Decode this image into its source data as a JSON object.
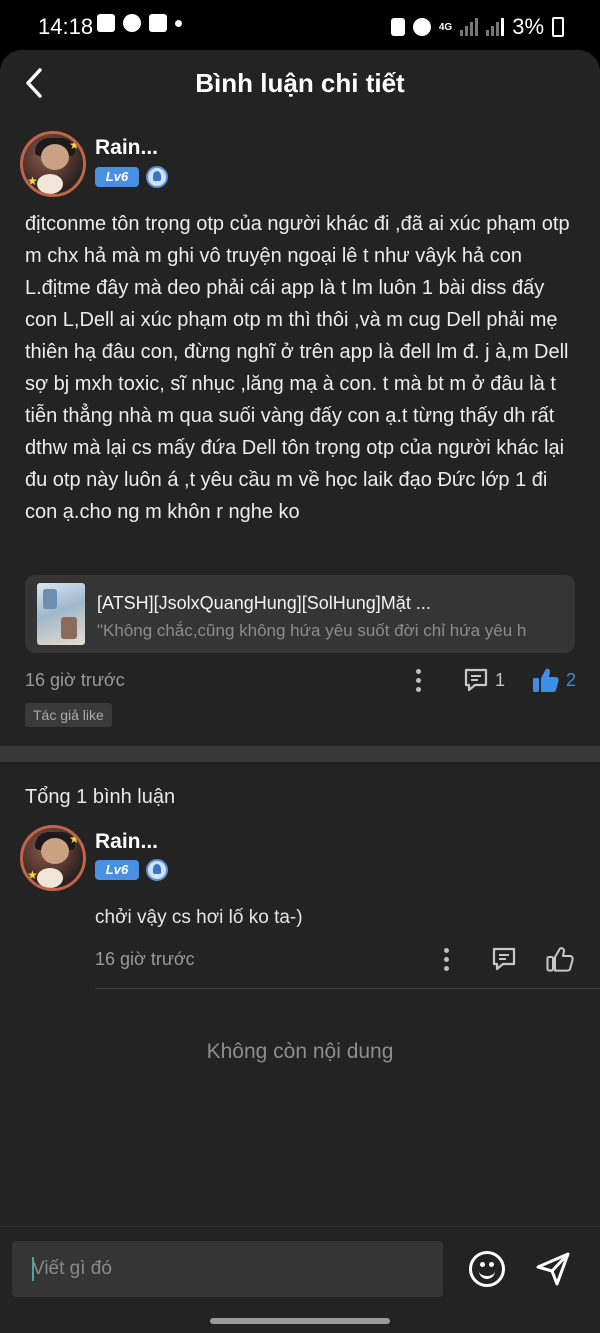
{
  "status_bar": {
    "time": "14:18",
    "network": "4G",
    "battery": "3%"
  },
  "header": {
    "title": "Bình luận chi tiết"
  },
  "post": {
    "username": "Rain...",
    "level": "Lv6",
    "body": "địtconme tôn trọng otp của người khác đi ,đã ai xúc phạm otp m chx hả mà m ghi vô truyện ngoại lê t như vâyk hả con L.địtme đây mà deo phải cái app là t lm luôn 1 bài diss đấy con L,Dell ai xúc phạm otp m thì thôi ,và m cug Dell phải mẹ thiên hạ đâu con, đừng nghĩ ở trên app là đell lm đ. j à,m Dell sợ bj mxh toxic, sĩ nhục ,lăng mạ à con. t mà bt m ở đâu là t tiễn thẳng nhà m qua suối vàng đấy con ạ.t từng thấy dh rất dthw mà lại cs mấy đứa Dell tôn trọng otp của người khác lại đu otp này luôn á ,t yêu cầu m về học laik đạo Đức lớp 1 đi con ạ.cho ng m khôn r nghe ko",
    "link_card": {
      "title": "[ATSH][JsolxQuangHung][SolHung]Mặt ...",
      "subtitle": "\"Không chắc,cũng không hứa yêu suốt đời chỉ hứa yêu h"
    },
    "time": "16 giờ trước",
    "comment_count": "1",
    "like_count": "2",
    "author_like_label": "Tác giả like"
  },
  "comments_section": {
    "title": "Tổng 1 bình luận",
    "items": [
      {
        "username": "Rain...",
        "level": "Lv6",
        "text": "chởi vậy cs hơi lố ko ta-)",
        "time": "16 giờ trước"
      }
    ],
    "end_text": "Không còn nội dung"
  },
  "input": {
    "placeholder": "Viết gì đó"
  },
  "colors": {
    "background": "#232323",
    "accent_blue": "#4a90e2",
    "like_active": "#3b8fe6"
  }
}
